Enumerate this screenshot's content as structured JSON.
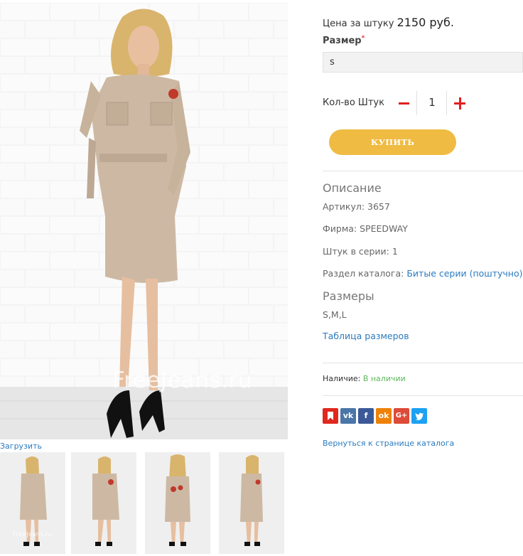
{
  "gallery": {
    "watermark": "FreeJeans.ru",
    "upload_label": "Загрузить",
    "thumb_watermark": "FreeJeans.ru"
  },
  "product": {
    "price_label": "Цена за штуку",
    "price_value": "2150 руб.",
    "size_label": "Размер",
    "required_mark": "*",
    "size_selected": "s",
    "qty_label": "Кол-во Штук",
    "qty_value": "1",
    "buy_label": "КУПИТЬ"
  },
  "description": {
    "title": "Описание",
    "article": "Артикул: 3657",
    "brand": "Фирма: SPEEDWAY",
    "series": "Штук в серии: 1",
    "catalog_prefix": "Раздел каталога: ",
    "catalog_link": "Битые серии (поштучно)",
    "sizes_title": "Размеры",
    "sizes_value": "S,M,L",
    "size_table_link": "Таблица размеров"
  },
  "availability": {
    "label": "Наличие: ",
    "status": "В наличии"
  },
  "social": [
    {
      "name": "bookmark-icon",
      "glyph": "▮",
      "color": "#e0281c"
    },
    {
      "name": "vk-icon",
      "glyph": "vk",
      "color": "#4a76a8"
    },
    {
      "name": "facebook-icon",
      "glyph": "f",
      "color": "#3b5998"
    },
    {
      "name": "odnoklassniki-icon",
      "glyph": "ok",
      "color": "#ee8208"
    },
    {
      "name": "google-plus-icon",
      "glyph": "G+",
      "color": "#dd4b39"
    },
    {
      "name": "twitter-icon",
      "glyph": "t",
      "color": "#1da1f2"
    }
  ],
  "back_link": "Вернуться к странице каталога",
  "colors": {
    "accent_button": "#efbb42",
    "link": "#2b7bbf",
    "in_stock": "#5cb85c",
    "qty_control": "#e02020"
  }
}
